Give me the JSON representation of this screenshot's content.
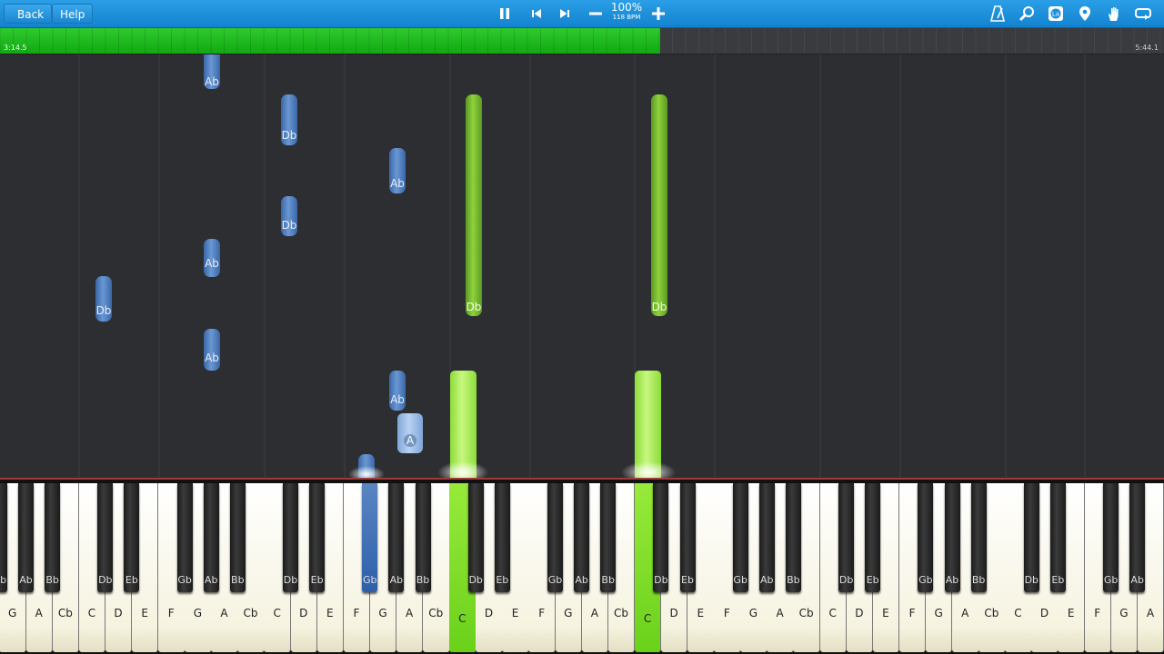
{
  "toolbar": {
    "back_label": "Back",
    "help_label": "Help",
    "speed_percent": "100%",
    "speed_bpm": "118 BPM",
    "icons": [
      "pause-icon",
      "skip-back-icon",
      "skip-forward-icon",
      "minus-icon",
      "plus-icon",
      "metronome-icon",
      "zoom-icon",
      "note-labels-icon",
      "location-icon",
      "hand-icon",
      "loop-icon"
    ]
  },
  "progress": {
    "fraction": 0.567,
    "elapsed": "3:14.5",
    "total": "5:44.1"
  },
  "colors": {
    "toolbar": "#1a8fda",
    "progress_green": "#1fbb1f",
    "note_blue": "#4f7fbf",
    "note_green": "#7ecb30",
    "background": "#2d2e31"
  },
  "keyboard": {
    "white_keys": [
      "G",
      "A",
      "Cb",
      "C",
      "D",
      "E",
      "F",
      "G",
      "A",
      "Cb",
      "C",
      "D",
      "E",
      "F",
      "G",
      "A",
      "Cb",
      "C",
      "D",
      "E",
      "F",
      "G",
      "A",
      "Cb",
      "C",
      "D",
      "E",
      "F",
      "G",
      "A",
      "Cb",
      "C",
      "D",
      "E",
      "F",
      "G",
      "A",
      "Cb",
      "C",
      "D",
      "E",
      "F",
      "G",
      "A"
    ],
    "black_keys": [
      "Gb",
      "Ab",
      "Bb",
      "Db",
      "Eb",
      "Gb",
      "Ab",
      "Bb",
      "Db",
      "Eb",
      "Gb",
      "Ab",
      "Bb",
      "Db",
      "Eb",
      "Gb",
      "Ab",
      "Bb",
      "Db",
      "Eb",
      "Gb",
      "Ab",
      "Bb",
      "Db",
      "Eb",
      "Gb",
      "Ab",
      "Bb",
      "Db",
      "Eb",
      "Gb",
      "Ab",
      "Bb",
      "Db",
      "Eb",
      "Gb",
      "Ab"
    ],
    "pressed_white": [
      17,
      24
    ],
    "pressed_black": [
      10
    ]
  },
  "notes": [
    {
      "label": "Ab",
      "color": "blue"
    },
    {
      "label": "Db",
      "color": "blue"
    },
    {
      "label": "Ab",
      "color": "blue"
    },
    {
      "label": "Db",
      "color": "blue"
    },
    {
      "label": "Ab",
      "color": "blue"
    },
    {
      "label": "Db",
      "color": "blue"
    },
    {
      "label": "Ab",
      "color": "blue"
    },
    {
      "label": "Ab",
      "color": "blue"
    },
    {
      "label": "A",
      "color": "light-blue"
    },
    {
      "label": "Db",
      "color": "green"
    },
    {
      "label": "Db",
      "color": "green"
    }
  ]
}
